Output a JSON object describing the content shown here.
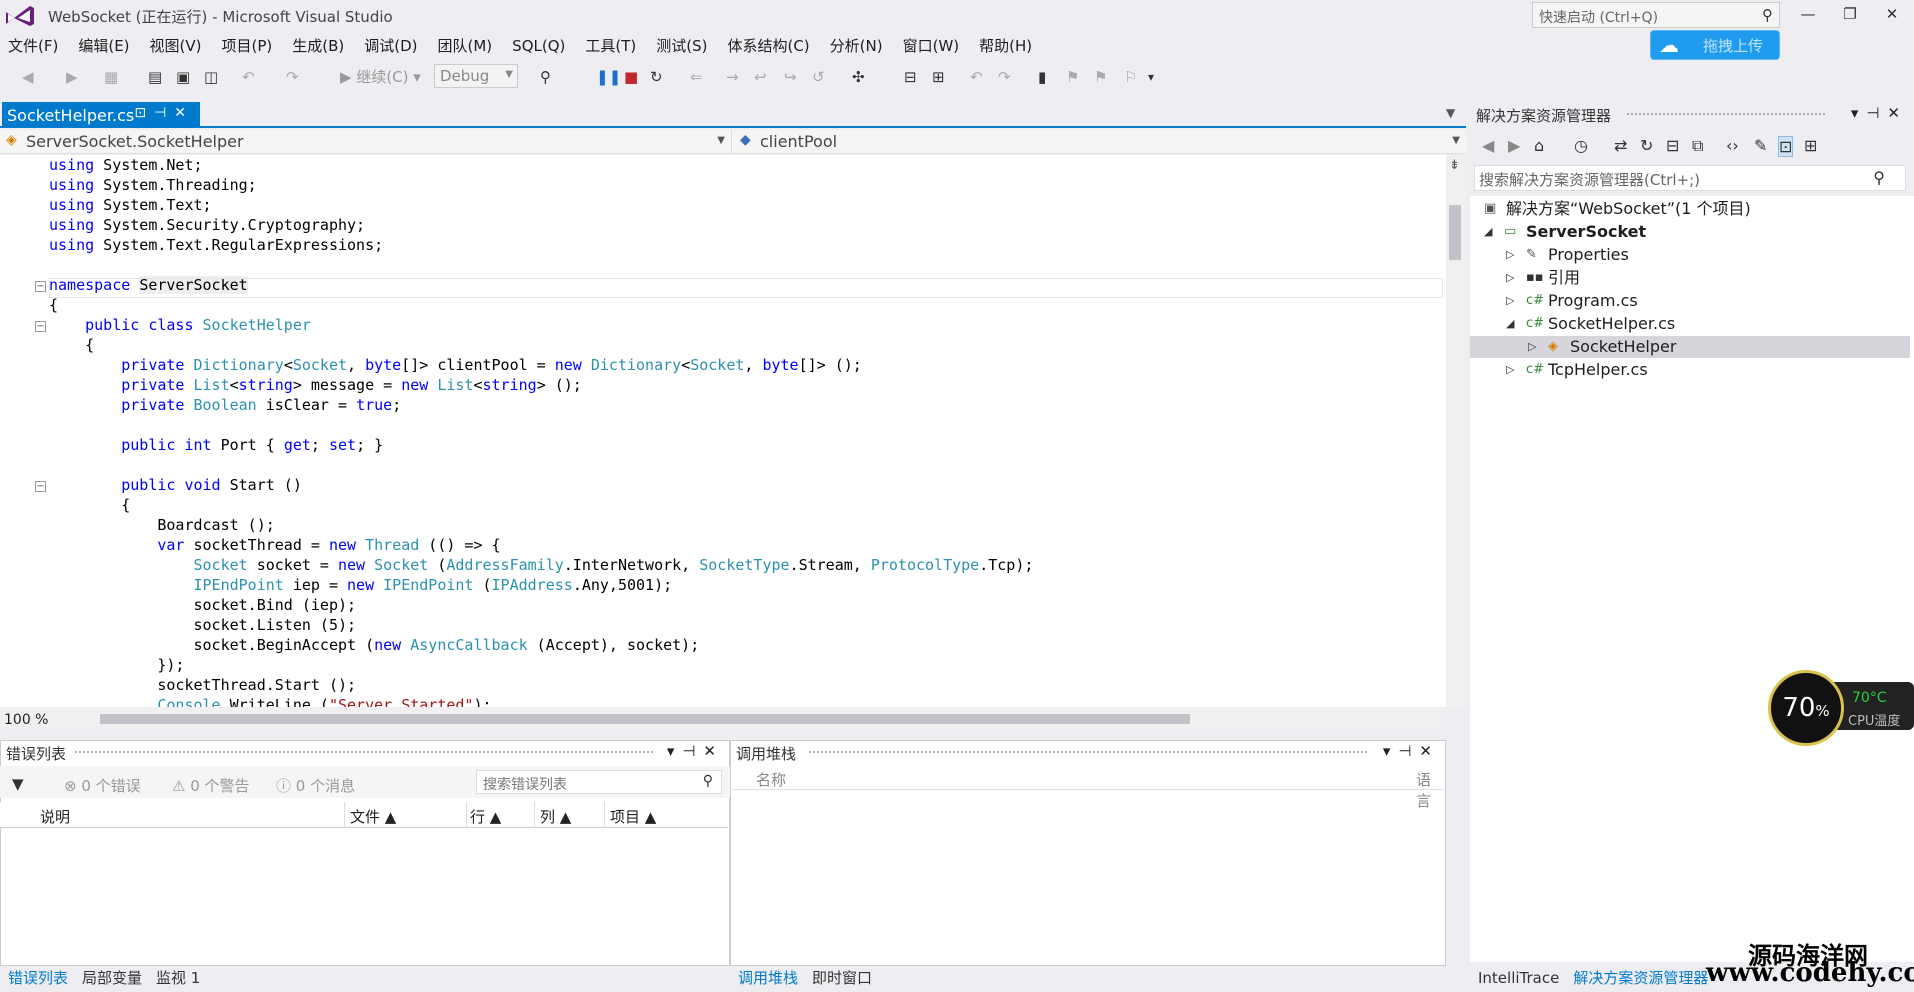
{
  "window": {
    "title": "WebSocket (正在运行) - Microsoft Visual Studio",
    "quick_launch_placeholder": "快速启动 (Ctrl+Q)",
    "minimize": "—",
    "restore": "❐",
    "close": "✕"
  },
  "menu": [
    "文件(F)",
    "编辑(E)",
    "视图(V)",
    "项目(P)",
    "生成(B)",
    "调试(D)",
    "团队(M)",
    "SQL(Q)",
    "工具(T)",
    "测试(S)",
    "体系结构(C)",
    "分析(N)",
    "窗口(W)",
    "帮助(H)"
  ],
  "upload_button": "拖拽上传",
  "toolbar": {
    "continue_label": "继续(C)",
    "config_combo": "Debug"
  },
  "editor": {
    "tab_label": "SocketHelper.cs",
    "nav_left": "ServerSocket.SocketHelper",
    "nav_right": "clientPool",
    "zoom": "100 %"
  },
  "errors": {
    "title": "错误列表",
    "errors_count": "0 个错误",
    "warnings_count": "0 个警告",
    "messages_count": "0 个消息",
    "search_placeholder": "搜索错误列表",
    "columns": [
      "说明",
      "文件",
      "行",
      "列",
      "项目"
    ]
  },
  "callstack": {
    "title": "调用堆栈",
    "col_name": "名称",
    "col_lang": "语言"
  },
  "bottom_tabs_left": [
    "错误列表",
    "局部变量",
    "监视 1"
  ],
  "bottom_tabs_right": [
    "调用堆栈",
    "即时窗口"
  ],
  "solution_explorer": {
    "title": "解决方案资源管理器",
    "search_placeholder": "搜索解决方案资源管理器(Ctrl+;)",
    "tree": [
      {
        "label": "解决方案“WebSocket”(1 个项目)"
      },
      {
        "label": "ServerSocket"
      },
      {
        "label": "Properties"
      },
      {
        "label": "引用"
      },
      {
        "label": "Program.cs"
      },
      {
        "label": "SocketHelper.cs"
      },
      {
        "label": "SocketHelper"
      },
      {
        "label": "TcpHelper.cs"
      }
    ],
    "bottom_tabs": [
      "IntelliTrace",
      "解决方案资源管理器"
    ]
  },
  "cpu_widget": {
    "percent": "70",
    "percent_sign": "%",
    "temperature": "70°C",
    "label": "CPU温度"
  },
  "watermark": {
    "name": "源码海洋网",
    "url": "www.codehy.com"
  },
  "colors": {
    "accent": "#007acc",
    "keyword": "#0000ff",
    "type": "#2b91af",
    "string": "#a31515"
  }
}
